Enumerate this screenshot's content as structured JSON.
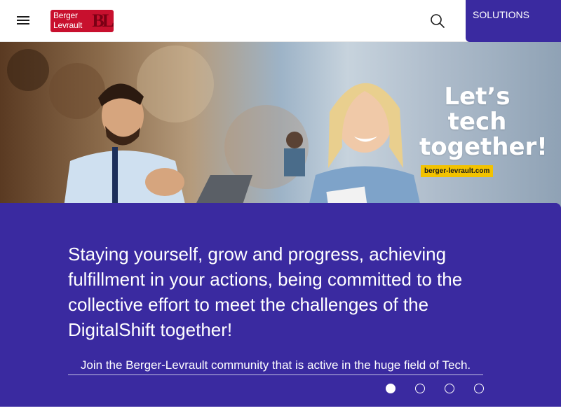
{
  "header": {
    "logo": {
      "line1": "Berger",
      "line2": "Levrault",
      "mark": "BL"
    },
    "menu_icon": "hamburger-menu-icon",
    "search_icon": "search-icon",
    "solutions_label": "SOLUTIONS"
  },
  "hero": {
    "tagline_line1": "Let’s",
    "tagline_line2": "tech",
    "tagline_line3": "together!",
    "tagline_url": "berger-levrault.com"
  },
  "panel": {
    "headline": "Staying yourself, grow and progress, achieving fulfillment in your actions, being committed to the collective effort to meet the challenges of the DigitalShift together!",
    "link_text": "Join the Berger-Levrault community that is active in the huge field of Tech."
  },
  "carousel": {
    "total": 4,
    "active": 1
  },
  "colors": {
    "brand_red": "#c8102e",
    "primary_purple": "#3a2aa0",
    "tag_yellow": "#f2c200"
  }
}
